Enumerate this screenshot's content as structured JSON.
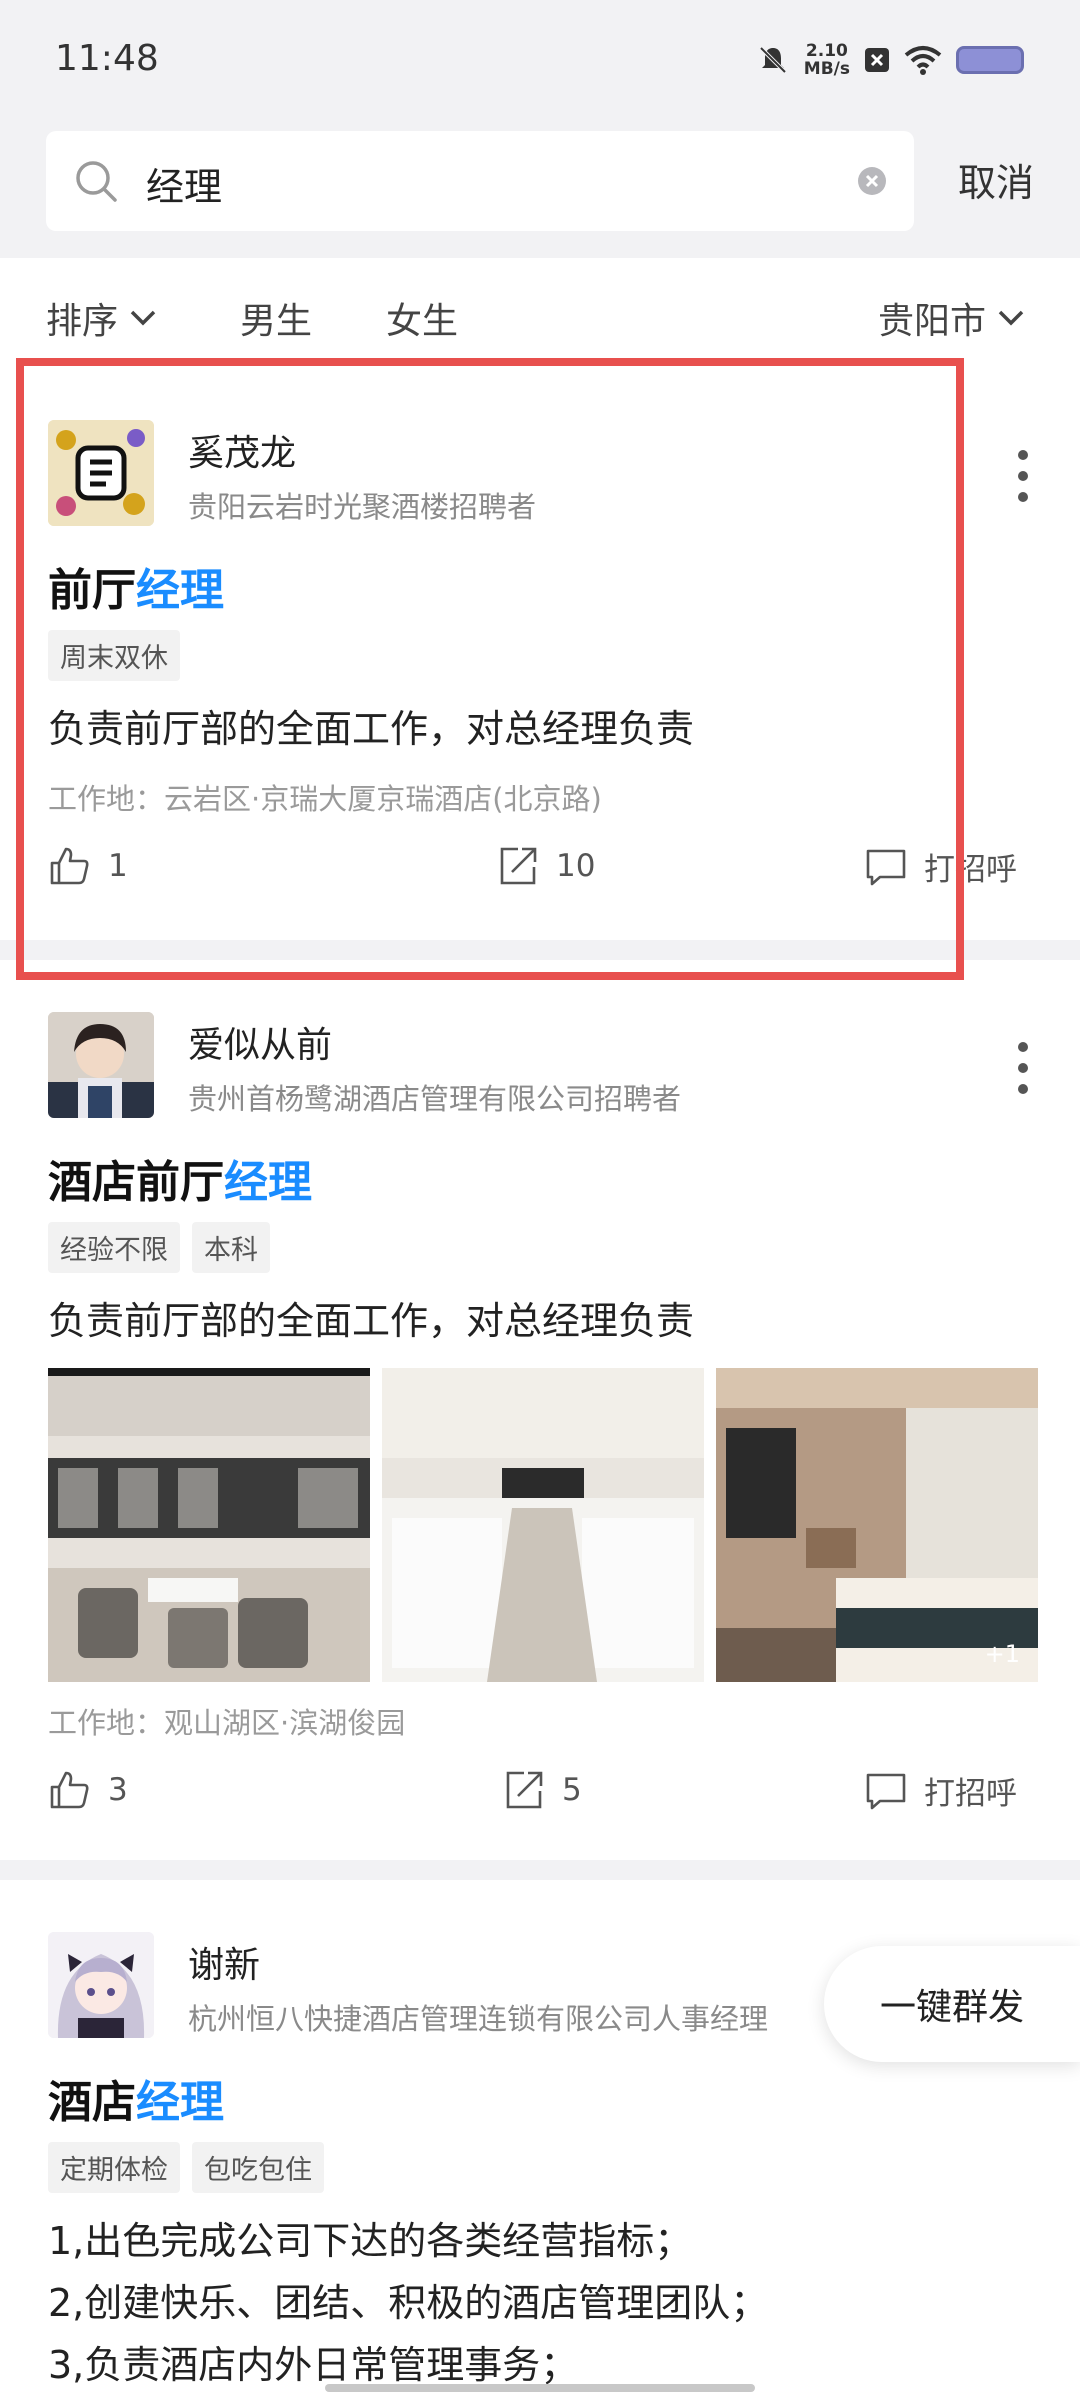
{
  "status_bar": {
    "time": "11:48",
    "net_speed_value": "2.10",
    "net_speed_unit": "MB/s"
  },
  "search": {
    "query": "经理",
    "cancel_label": "取消"
  },
  "filters": {
    "sort_label": "排序",
    "male_label": "男生",
    "female_label": "女生",
    "city_label": "贵阳市"
  },
  "posts": [
    {
      "author": "奚茂龙",
      "company": "贵阳云岩时光聚酒楼招聘者",
      "title_prefix": "前厅",
      "title_highlight": "经理",
      "tags": [
        "周末双休"
      ],
      "description": "负责前厅部的全面工作，对总经理负责",
      "location": "工作地：云岩区·京瑞大厦京瑞酒店(北京路)",
      "likes": "1",
      "shares": "10",
      "greet_label": "打招呼"
    },
    {
      "author": "爱似从前",
      "company": "贵州首杨鹭湖酒店管理有限公司招聘者",
      "title_prefix": "酒店前厅",
      "title_highlight": "经理",
      "tags": [
        "经验不限",
        "本科"
      ],
      "description": "负责前厅部的全面工作，对总经理负责",
      "photo_more": "+1",
      "location": "工作地：观山湖区·滨湖俊园",
      "likes": "3",
      "shares": "5",
      "greet_label": "打招呼"
    },
    {
      "author": "谢新",
      "company": "杭州恒八快捷酒店管理连锁有限公司人事经理",
      "title_prefix": "酒店",
      "title_highlight": "经理",
      "tags": [
        "定期体检",
        "包吃包住"
      ],
      "description_lines": [
        "1,出色完成公司下达的各类经营指标；",
        "2,创建快乐、团结、积极的酒店管理团队；",
        "3,负责酒店内外日常管理事务；"
      ]
    }
  ],
  "fab_label": "一键群发",
  "colors": {
    "highlight": "#1a8cff",
    "selection_frame": "#e8504e",
    "background": "#f2f2f4"
  },
  "icons": [
    "search-icon",
    "clear-icon",
    "chevron-down-icon",
    "more-icon",
    "thumbs-up-icon",
    "share-icon",
    "chat-icon"
  ]
}
